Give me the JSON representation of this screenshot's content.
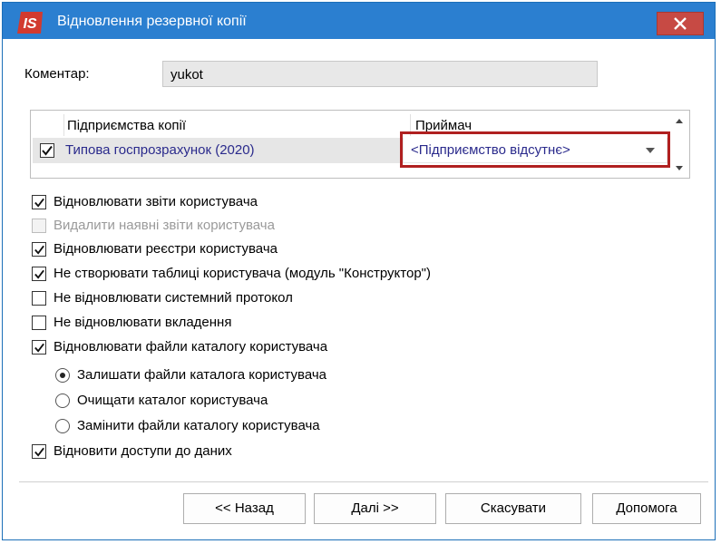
{
  "window": {
    "title": "Відновлення резервної копії",
    "logo_text": "IS"
  },
  "comment": {
    "label": "Коментар:",
    "value": "yukot"
  },
  "grid": {
    "col_company": "Підприємства копії",
    "col_receiver": "Приймач",
    "row": {
      "checked": true,
      "company": "Типова госпрозрахунок (2020)",
      "receiver": "<Підприємство відсутнє>"
    }
  },
  "options": [
    {
      "label": "Відновлювати звіти користувача",
      "checked": true,
      "disabled": false
    },
    {
      "label": "Видалити наявні звіти  користувача",
      "checked": false,
      "disabled": true
    },
    {
      "label": "Відновлювати реєстри користувача",
      "checked": true,
      "disabled": false
    },
    {
      "label": "Не створювати таблиці користувача (модуль \"Конструктор\")",
      "checked": true,
      "disabled": false
    },
    {
      "label": "Не відновлювати системний протокол",
      "checked": false,
      "disabled": false
    },
    {
      "label": "Не відновлювати вкладення",
      "checked": false,
      "disabled": false
    },
    {
      "label": "Відновлювати файли каталогу користувача",
      "checked": true,
      "disabled": false
    }
  ],
  "radios": [
    {
      "label": "Залишати файли каталога користувача",
      "selected": true
    },
    {
      "label": "Очищати каталог користувача",
      "selected": false
    },
    {
      "label": "Замінити файли каталогу користувача",
      "selected": false
    }
  ],
  "access": {
    "label": "Відновити доступи до даних",
    "checked": true
  },
  "buttons": {
    "back": "<< Назад",
    "next": "Далі >>",
    "cancel": "Скасувати",
    "help": "Допомога"
  },
  "colors": {
    "titlebar": "#2b7fd0",
    "close": "#c74a44",
    "highlight": "#b02020",
    "link_text": "#2a2a8c"
  }
}
